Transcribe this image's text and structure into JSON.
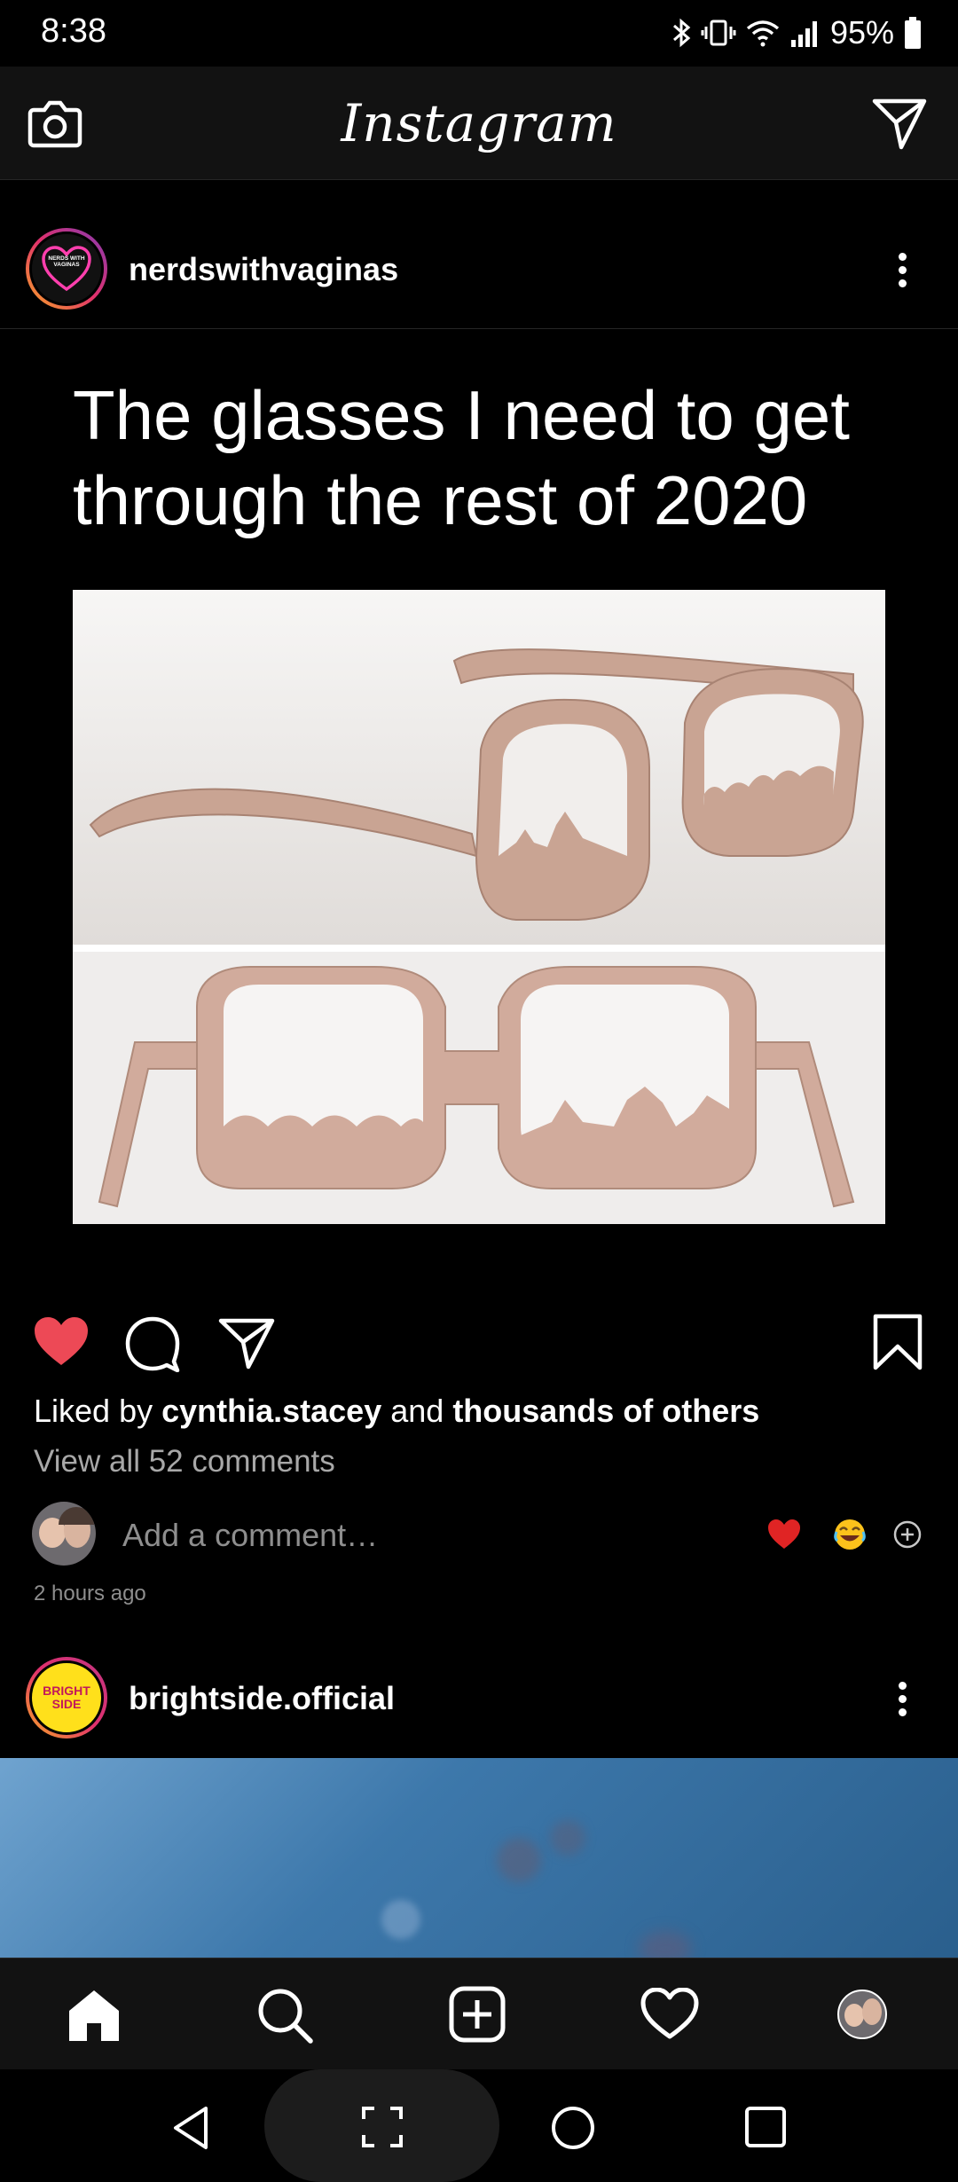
{
  "status_bar": {
    "time": "8:38",
    "battery": "95%"
  },
  "app_title": "Instagram",
  "post1": {
    "username": "nerdswithvaginas",
    "avatar_text": "NERDS WITH VAGINAS",
    "meme_caption": "The glasses I need to get through the rest of 2020",
    "liked_prefix": "Liked by ",
    "liked_user": "cynthia.stacey",
    "liked_and": " and ",
    "liked_others": "thousands of others",
    "view_comments": "View all 52 comments",
    "comment_placeholder": "Add a comment…",
    "time_ago": "2 hours ago"
  },
  "post2": {
    "username": "brightside.official",
    "avatar_text_1": "BRIGHT",
    "avatar_text_2": "SIDE"
  },
  "colors": {
    "like_red": "#ed4956",
    "background": "#000000",
    "bar": "#121212",
    "bright_yellow": "#ffe01b"
  }
}
